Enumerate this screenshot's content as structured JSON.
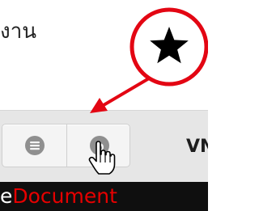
{
  "top_text": "งาน",
  "annotation": {
    "icon": "star-icon",
    "color": "#e30613"
  },
  "toolbar": {
    "menu_icon": "menu-icon",
    "back_icon": "undo-back-icon",
    "text": "VN"
  },
  "brand": {
    "first": "e",
    "rest": "Document"
  },
  "cursor_icon": "hand-pointer-icon"
}
